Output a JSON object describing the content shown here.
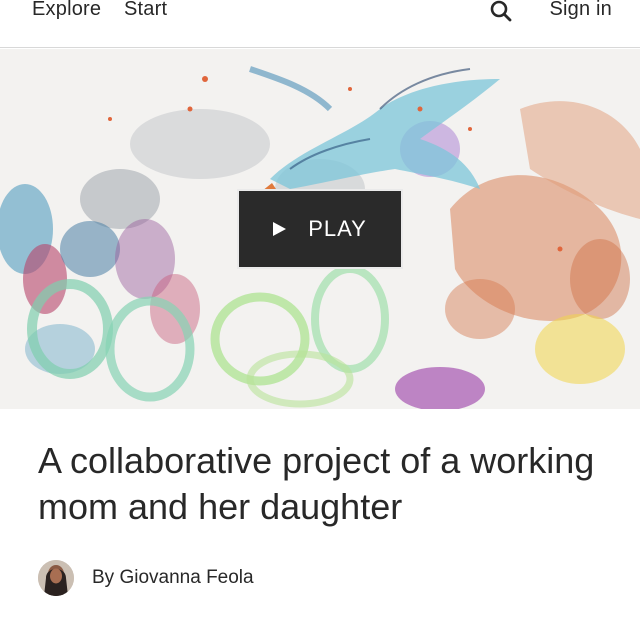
{
  "nav": {
    "explore_label": "Explore",
    "start_label": "Start",
    "signin_label": "Sign in",
    "search_icon": "search-icon"
  },
  "hero": {
    "play_label": "PLAY",
    "play_icon": "play-icon"
  },
  "article": {
    "title": "A collaborative project of a working mom and her daughter",
    "author": "By Giovanna Feola"
  }
}
